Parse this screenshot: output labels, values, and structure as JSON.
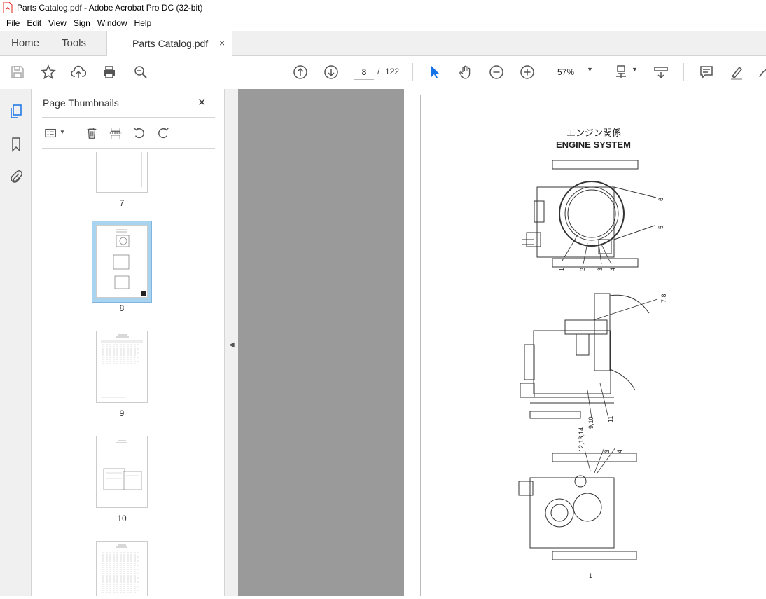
{
  "window": {
    "title": "Parts Catalog.pdf - Adobe Acrobat Pro DC (32-bit)"
  },
  "menu": [
    "File",
    "Edit",
    "View",
    "Sign",
    "Window",
    "Help"
  ],
  "tabs": {
    "home": "Home",
    "tools": "Tools",
    "document": "Parts Catalog.pdf",
    "close": "×"
  },
  "toolbar": {
    "current_page": "8",
    "separator": "/",
    "total_pages": "122",
    "zoom": "57%"
  },
  "panel": {
    "title": "Page Thumbnails",
    "close": "×",
    "thumbnails": [
      {
        "label": "7"
      },
      {
        "label": "8",
        "selected": true
      },
      {
        "label": "9"
      },
      {
        "label": "10"
      }
    ]
  },
  "page": {
    "heading_jp": "エンジン関係",
    "heading_en": "ENGINE SYSTEM",
    "callouts": [
      "6",
      "5",
      "1",
      "2",
      "3",
      "4",
      "7,8",
      "9,10",
      "11",
      "12,13,14",
      "3",
      "4"
    ],
    "page_number": "1"
  },
  "colors": {
    "accent": "#1473e6",
    "selection": "#a8d4f0",
    "viewer_bg": "#9a9a9a",
    "pdf_red": "#e0201a"
  }
}
